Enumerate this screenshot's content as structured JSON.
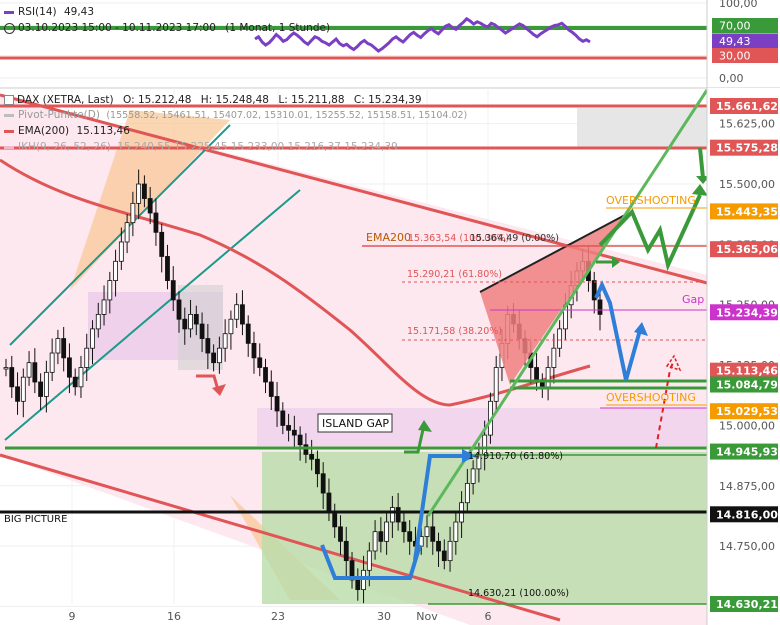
{
  "chart_data": [
    {
      "type": "line",
      "name_panel": "rsi",
      "legend": {
        "name": "RSI(14)",
        "value": "49,43"
      },
      "period": "03.10.2023 15:00 - 10.11.2023 17:00",
      "period_note": "(1 Monat, 1 Stunde)",
      "y_ticks": [
        "100,00",
        "70,00",
        "30,00",
        "0,00"
      ],
      "levels": {
        "upper": 70,
        "lower": 30
      },
      "last_value_box": "49,43",
      "upper_box": "70,00",
      "lower_box": "30,00",
      "ylim": [
        0,
        100
      ],
      "values": [
        52,
        55,
        48,
        44,
        47,
        52,
        58,
        54,
        49,
        51,
        56,
        60,
        57,
        53,
        48,
        45,
        50,
        55,
        53,
        49,
        47,
        44,
        48,
        52,
        46,
        43,
        45,
        41,
        38,
        42,
        47,
        50,
        46,
        44,
        40,
        36,
        39,
        43,
        47,
        52,
        55,
        51,
        48,
        53,
        58,
        61,
        57,
        54,
        59,
        63,
        66,
        62,
        59,
        64,
        69,
        71,
        67,
        65,
        70,
        74,
        79,
        76,
        72,
        75,
        73,
        70,
        68,
        73,
        71,
        67,
        64,
        60,
        63,
        66,
        69,
        72,
        70,
        66,
        62,
        58,
        55,
        59,
        62,
        65,
        68,
        70,
        71,
        73,
        69,
        64,
        61,
        57,
        52,
        49,
        51,
        48
      ]
    },
    {
      "type": "line",
      "name_panel": "price",
      "instrument": "DAX (XETRA, Last)",
      "ohlc": {
        "O": "15.212,48",
        "H": "15.248,48",
        "L": "15.211,88",
        "C": "15.234,39"
      },
      "indicators": [
        {
          "label": "Pivot-Punkte(D)",
          "values": "(15558.52, 15461.51, 15407.02, 15310.01, 15255.52, 15158.51, 15104.02)",
          "color": "#bdbdbd"
        },
        {
          "label": "EMA(200)",
          "values": "15.113,46",
          "color": "#e05555"
        },
        {
          "label": "IKH(9, 26, 52, 26)",
          "values": "15.240,55 15.225,45 15.233,00 15.216,37 15.234,39",
          "color": "#f0b8c8"
        }
      ],
      "ylim": [
        14600,
        15710
      ],
      "y_ticks": [
        "15.625,00",
        "15.500,00",
        "15.375,00",
        "15.250,00",
        "15.125,00",
        "15.000,00",
        "14.875,00",
        "14.750,00",
        "14.625,00"
      ],
      "x_ticks": [
        "9",
        "16",
        "23",
        "30",
        "Nov",
        "6"
      ],
      "price_boxes": [
        {
          "value": 15661.62,
          "text": "15.661,62",
          "color": "#e05555"
        },
        {
          "value": 15575.28,
          "text": "15.575,28",
          "color": "#e05555"
        },
        {
          "value": 15443.35,
          "text": "15.443,35",
          "color": "#f59b00"
        },
        {
          "value": 15365.06,
          "text": "15.365,06",
          "color": "#e05555"
        },
        {
          "value": 15234.39,
          "text": "15.234,39",
          "color": "#cc33cc"
        },
        {
          "value": 15113.46,
          "text": "15.113,46",
          "color": "#e05555"
        },
        {
          "value": 15084.79,
          "text": "15.084,79",
          "color": "#3a9a3a"
        },
        {
          "value": 15029.53,
          "text": "15.029,53",
          "color": "#f59b00"
        },
        {
          "value": 14945.93,
          "text": "14.945,93",
          "color": "#3a9a3a"
        },
        {
          "value": 14816.0,
          "text": "14.816,00",
          "color": "#111111"
        },
        {
          "value": 14630.21,
          "text": "14.630,21",
          "color": "#3a9a3a"
        }
      ],
      "annotations": {
        "overshooting": "OVERSHOOTING",
        "ema200": "EMA200",
        "fib_0": "15.363,54 (100.00%)",
        "fib_0b": "15.364,49 (0.00%)",
        "fib_618": "15.290,21 (61.80%)",
        "fib_382": "15.171,58 (38.20%)",
        "gap": "Gap",
        "island_gap": "ISLAND GAP",
        "fib_low_618": "14.910,70 (61.80%)",
        "fib_low_100": "14.630,21 (100.00%)",
        "big_picture": "BIG PICTURE"
      },
      "closes": [
        15120,
        15080,
        15050,
        15100,
        15130,
        15090,
        15060,
        15110,
        15150,
        15180,
        15140,
        15100,
        15080,
        15120,
        15160,
        15200,
        15230,
        15260,
        15300,
        15340,
        15380,
        15420,
        15460,
        15500,
        15470,
        15440,
        15400,
        15350,
        15300,
        15260,
        15220,
        15200,
        15230,
        15210,
        15180,
        15150,
        15130,
        15160,
        15190,
        15220,
        15250,
        15210,
        15170,
        15140,
        15120,
        15090,
        15060,
        15030,
        15000,
        14990,
        14980,
        14960,
        14940,
        14930,
        14900,
        14860,
        14820,
        14790,
        14760,
        14720,
        14680,
        14660,
        14700,
        14740,
        14780,
        14760,
        14800,
        14830,
        14800,
        14780,
        14760,
        14750,
        14770,
        14790,
        14760,
        14740,
        14720,
        14760,
        14800,
        14840,
        14880,
        14910,
        14940,
        14980,
        15050,
        15120,
        15170,
        15230,
        15210,
        15180,
        15150,
        15120,
        15090,
        15080,
        15120,
        15160,
        15200,
        15250,
        15290,
        15320,
        15340,
        15300,
        15260,
        15230
      ]
    }
  ]
}
